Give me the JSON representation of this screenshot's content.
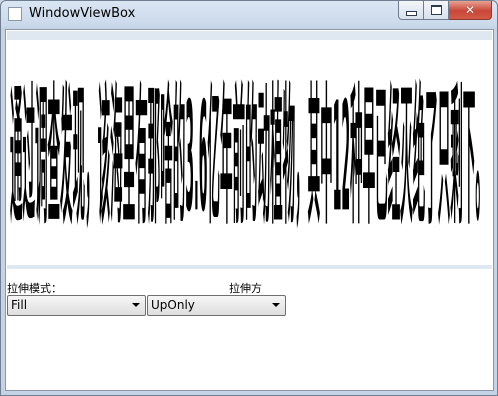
{
  "window": {
    "title": "WindowViewBox",
    "controls": {
      "minimize_icon": "minimize-icon",
      "maximize_icon": "maximize-icon",
      "close_icon": "close-icon",
      "close_glyph": "✕"
    }
  },
  "viewbox": {
    "text": "通过调查发现，该海里有那啥的3.6亿年前的动植物，其中12种早已经灭绝了只剩下。"
  },
  "controls": {
    "stretch_mode_label": "拉伸模式：",
    "stretch_direction_label": "拉伸方",
    "stretch_mode_value": "Fill",
    "stretch_direction_value": "UpOnly"
  }
}
